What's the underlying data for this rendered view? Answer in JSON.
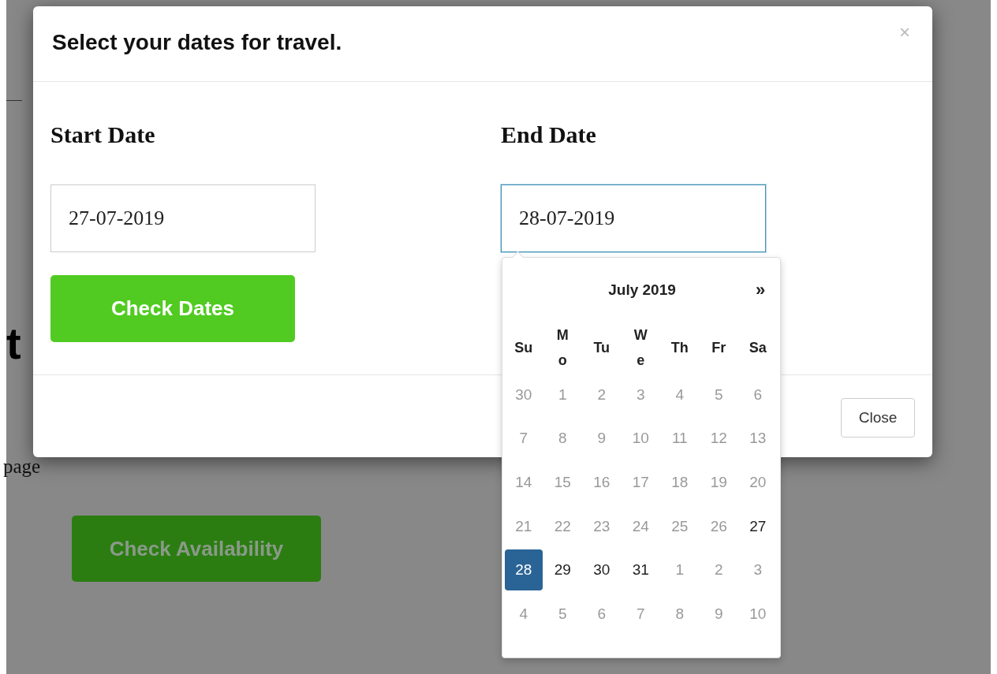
{
  "background_page": {
    "heading": "t",
    "text": "page",
    "button": "Check Availability"
  },
  "modal": {
    "title": "Select your dates for travel.",
    "close_icon": "×",
    "fields": [
      {
        "label": "Start Date",
        "value": "27-07-2019",
        "focused": false
      },
      {
        "label": "End Date",
        "value": "28-07-2019",
        "focused": true
      }
    ],
    "submit_button": "Check Dates",
    "footer_button": "Close"
  },
  "datepicker": {
    "month": "July 2019",
    "next": "»",
    "weekdays": [
      "Su",
      "Mo",
      "Tu",
      "We",
      "Th",
      "Fr",
      "Sa"
    ],
    "weeks": [
      [
        {
          "label": "30",
          "disabled": true,
          "selected": false
        },
        {
          "label": "1",
          "disabled": true,
          "selected": false
        },
        {
          "label": "2",
          "disabled": true,
          "selected": false
        },
        {
          "label": "3",
          "disabled": true,
          "selected": false
        },
        {
          "label": "4",
          "disabled": true,
          "selected": false
        },
        {
          "label": "5",
          "disabled": true,
          "selected": false
        },
        {
          "label": "6",
          "disabled": true,
          "selected": false
        }
      ],
      [
        {
          "label": "7",
          "disabled": true,
          "selected": false
        },
        {
          "label": "8",
          "disabled": true,
          "selected": false
        },
        {
          "label": "9",
          "disabled": true,
          "selected": false
        },
        {
          "label": "10",
          "disabled": true,
          "selected": false
        },
        {
          "label": "11",
          "disabled": true,
          "selected": false
        },
        {
          "label": "12",
          "disabled": true,
          "selected": false
        },
        {
          "label": "13",
          "disabled": true,
          "selected": false
        }
      ],
      [
        {
          "label": "14",
          "disabled": true,
          "selected": false
        },
        {
          "label": "15",
          "disabled": true,
          "selected": false
        },
        {
          "label": "16",
          "disabled": true,
          "selected": false
        },
        {
          "label": "17",
          "disabled": true,
          "selected": false
        },
        {
          "label": "18",
          "disabled": true,
          "selected": false
        },
        {
          "label": "19",
          "disabled": true,
          "selected": false
        },
        {
          "label": "20",
          "disabled": true,
          "selected": false
        }
      ],
      [
        {
          "label": "21",
          "disabled": true,
          "selected": false
        },
        {
          "label": "22",
          "disabled": true,
          "selected": false
        },
        {
          "label": "23",
          "disabled": true,
          "selected": false
        },
        {
          "label": "24",
          "disabled": true,
          "selected": false
        },
        {
          "label": "25",
          "disabled": true,
          "selected": false
        },
        {
          "label": "26",
          "disabled": true,
          "selected": false
        },
        {
          "label": "27",
          "disabled": false,
          "selected": false
        }
      ],
      [
        {
          "label": "28",
          "disabled": false,
          "selected": true
        },
        {
          "label": "29",
          "disabled": false,
          "selected": false
        },
        {
          "label": "30",
          "disabled": false,
          "selected": false
        },
        {
          "label": "31",
          "disabled": false,
          "selected": false
        },
        {
          "label": "1",
          "disabled": true,
          "selected": false
        },
        {
          "label": "2",
          "disabled": true,
          "selected": false
        },
        {
          "label": "3",
          "disabled": true,
          "selected": false
        }
      ],
      [
        {
          "label": "4",
          "disabled": true,
          "selected": false
        },
        {
          "label": "5",
          "disabled": true,
          "selected": false
        },
        {
          "label": "6",
          "disabled": true,
          "selected": false
        },
        {
          "label": "7",
          "disabled": true,
          "selected": false
        },
        {
          "label": "8",
          "disabled": true,
          "selected": false
        },
        {
          "label": "9",
          "disabled": true,
          "selected": false
        },
        {
          "label": "10",
          "disabled": true,
          "selected": false
        }
      ]
    ]
  }
}
